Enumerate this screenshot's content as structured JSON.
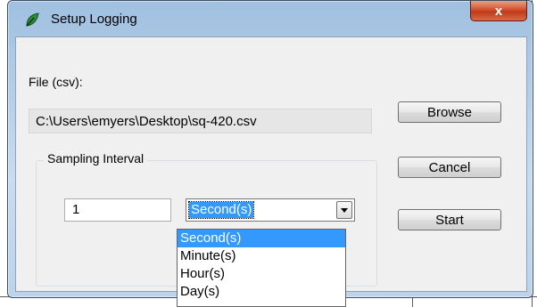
{
  "window": {
    "title": "Setup Logging",
    "close_label": "x"
  },
  "file": {
    "label": "File (csv):",
    "path": "C:\\Users\\emyers\\Desktop\\sq-420.csv"
  },
  "buttons": {
    "browse": "Browse",
    "cancel": "Cancel",
    "start": "Start"
  },
  "sampling": {
    "group_label": "Sampling Interval",
    "interval_value": "1",
    "unit_selected": "Second(s)",
    "unit_options": [
      "Second(s)",
      "Minute(s)",
      "Hour(s)",
      "Day(s)"
    ]
  },
  "colors": {
    "selection": "#3399ff",
    "close_button": "#c8421e"
  }
}
